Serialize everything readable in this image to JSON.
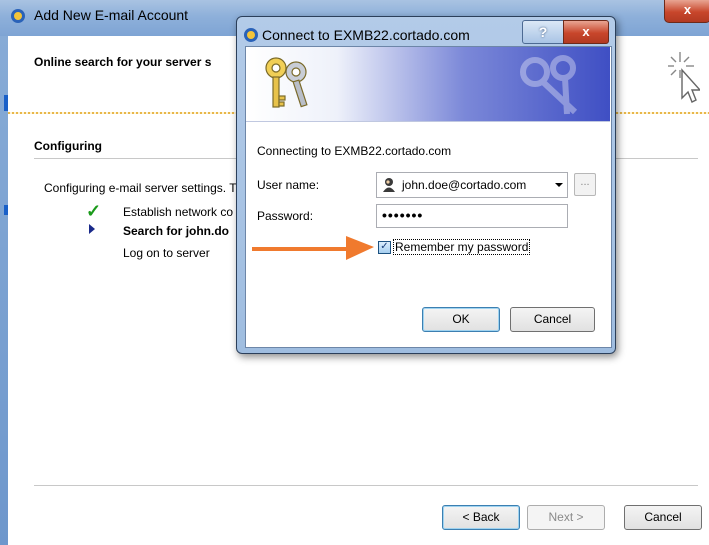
{
  "wizard": {
    "title": "Add New E-mail Account",
    "close_glyph": "x",
    "header_title": "Online search for your server s",
    "section_title": "Configuring",
    "status_text": "Configuring e-mail server settings. T",
    "steps": [
      {
        "label": "Establish network co",
        "state": "done"
      },
      {
        "label": "Search for john.do",
        "state": "current"
      },
      {
        "label": "Log on to server",
        "state": "pending"
      }
    ],
    "buttons": {
      "back": "< Back",
      "next": "Next >",
      "cancel": "Cancel"
    }
  },
  "dialog": {
    "title": "Connect to EXMB22.cortado.com",
    "help_glyph": "?",
    "close_glyph": "x",
    "connecting_text": "Connecting to EXMB22.cortado.com",
    "username_label": "User name:",
    "username_value": "john.doe@cortado.com",
    "more_glyph": "...",
    "password_label": "Password:",
    "password_mask": "•••••••",
    "remember_label": "Remember my password",
    "remember_checked": true,
    "check_glyph": "✓",
    "ok_label": "OK",
    "cancel_label": "Cancel"
  },
  "colors": {
    "annotation_arrow": "#f07a2e",
    "title_bar": "#8eb0da",
    "close_red": "#c8462b"
  },
  "icons": [
    "app-icon",
    "cursor-icon",
    "check-icon",
    "arrow-icon",
    "keys-icon",
    "user-icon",
    "dropdown-icon"
  ]
}
